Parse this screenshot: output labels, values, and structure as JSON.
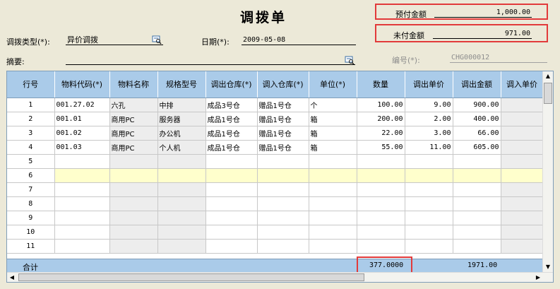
{
  "title": "调拨单",
  "prepaid": {
    "label": "预付金额",
    "value": "1,000.00"
  },
  "unpaid": {
    "label": "未付金额",
    "value": "971.00"
  },
  "transfer_type": {
    "label": "调拨类型(*):",
    "value": "异价调拨"
  },
  "date": {
    "label": "日期(*):",
    "value": "2009-05-08"
  },
  "summary": {
    "label": "摘要:",
    "value": ""
  },
  "doc_no": {
    "label": "编号(*):",
    "value": "CHG000012"
  },
  "columns": [
    "行号",
    "物料代码(*)",
    "物料名称",
    "规格型号",
    "调出仓库(*)",
    "调入仓库(*)",
    "单位(*)",
    "数量",
    "调出单价",
    "调出金额",
    "调入单价"
  ],
  "rows": [
    {
      "no": "1",
      "code": "001.27.02",
      "name": "六孔",
      "spec": "中排",
      "out_wh": "成品3号仓",
      "in_wh": "赠品1号仓",
      "unit": "个",
      "qty": "100.00",
      "out_price": "9.00",
      "out_amount": "900.00"
    },
    {
      "no": "2",
      "code": "001.01",
      "name": "商用PC",
      "spec": "服务器",
      "out_wh": "成品1号仓",
      "in_wh": "赠品1号仓",
      "unit": "箱",
      "qty": "200.00",
      "out_price": "2.00",
      "out_amount": "400.00"
    },
    {
      "no": "3",
      "code": "001.02",
      "name": "商用PC",
      "spec": "办公机",
      "out_wh": "成品1号仓",
      "in_wh": "赠品1号仓",
      "unit": "箱",
      "qty": "22.00",
      "out_price": "3.00",
      "out_amount": "66.00"
    },
    {
      "no": "4",
      "code": "001.03",
      "name": "商用PC",
      "spec": "个人机",
      "out_wh": "成品1号仓",
      "in_wh": "赠品1号仓",
      "unit": "箱",
      "qty": "55.00",
      "out_price": "11.00",
      "out_amount": "605.00"
    },
    {
      "no": "5"
    },
    {
      "no": "6"
    },
    {
      "no": "7"
    },
    {
      "no": "8"
    },
    {
      "no": "9"
    },
    {
      "no": "10"
    },
    {
      "no": "11"
    }
  ],
  "totals": {
    "label": "合计",
    "qty": "377.0000",
    "amount": "1971.00"
  }
}
